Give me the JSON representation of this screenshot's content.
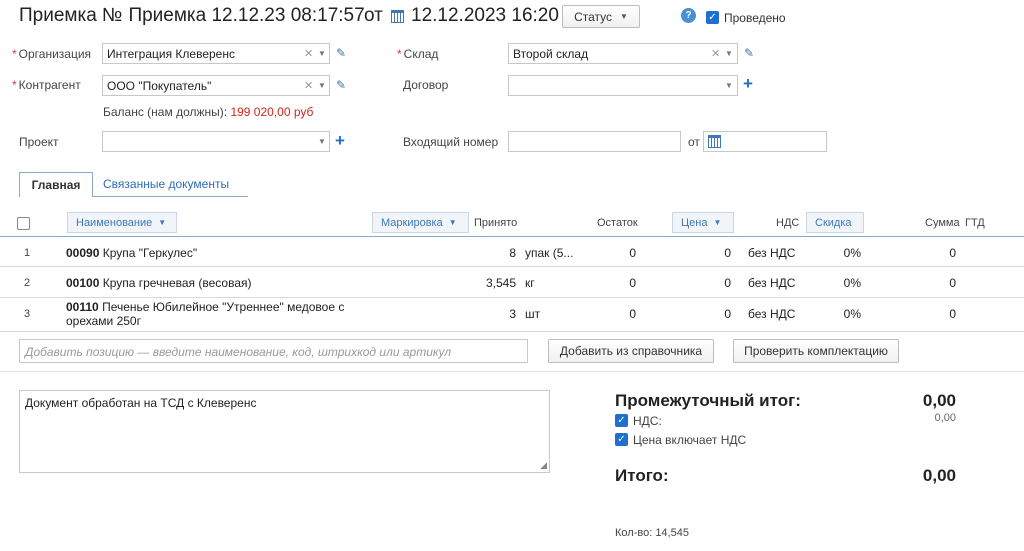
{
  "header": {
    "title": "Приемка №",
    "doc_number": "Приемка 12.12.23 08:17:57",
    "from_label": "от",
    "date": "12.12.2023 16:20",
    "status_label": "Статус",
    "help": "?",
    "posted_label": "Проведено",
    "posted_checked": true
  },
  "form": {
    "organization": {
      "label": "Организация",
      "value": "Интеграция Клеверенс"
    },
    "warehouse": {
      "label": "Склад",
      "value": "Второй склад"
    },
    "counterparty": {
      "label": "Контрагент",
      "value": "ООО \"Покупатель\""
    },
    "contract": {
      "label": "Договор",
      "value": ""
    },
    "balance_label": "Баланс (нам должны):",
    "balance_value": "199 020,00 руб",
    "project": {
      "label": "Проект",
      "value": ""
    },
    "incoming_number": {
      "label": "Входящий номер",
      "value": ""
    },
    "incoming_from_label": "от",
    "incoming_date": ""
  },
  "tabs": [
    {
      "label": "Главная",
      "active": true
    },
    {
      "label": "Связанные документы",
      "active": false
    }
  ],
  "table": {
    "columns": {
      "name": "Наименование",
      "marking": "Маркировка",
      "accepted": "Принято",
      "remainder": "Остаток",
      "price": "Цена",
      "vat": "НДС",
      "discount": "Скидка",
      "sum": "Сумма",
      "gtd": "ГТД"
    },
    "rows": [
      {
        "n": "1",
        "code": "00090",
        "name": "Крупа \"Геркулес\"",
        "name2": "",
        "qty": "8",
        "unit": "упак (5...",
        "remainder": "0",
        "price": "0",
        "vat": "без НДС",
        "discount": "0%",
        "sum": "0"
      },
      {
        "n": "2",
        "code": "00100",
        "name": "Крупа гречневая (весовая)",
        "name2": "",
        "qty": "3,545",
        "unit": "кг",
        "remainder": "0",
        "price": "0",
        "vat": "без НДС",
        "discount": "0%",
        "sum": "0"
      },
      {
        "n": "3",
        "code": "00110",
        "name": "Печенье Юбилейное \"Утреннее\" медовое с",
        "name2": "орехами 250г",
        "qty": "3",
        "unit": "шт",
        "remainder": "0",
        "price": "0",
        "vat": "без НДС",
        "discount": "0%",
        "sum": "0"
      }
    ]
  },
  "add_position": {
    "placeholder": "Добавить позицию — введите наименование, код, штрихкод или артикул",
    "from_catalog_label": "Добавить из справочника",
    "check_kit_label": "Проверить комплектацию"
  },
  "comment": "Документ обработан на ТСД с Клеверенс",
  "totals": {
    "subtotal_label": "Промежуточный итог:",
    "subtotal_value": "0,00",
    "vat_label": "НДС:",
    "vat_value": "0,00",
    "vat_checked": true,
    "price_incl_vat_label": "Цена включает НДС",
    "price_incl_vat_checked": true,
    "total_label": "Итого:",
    "total_value": "0,00",
    "qty_label": "Кол-во: 14,545"
  },
  "colors": {
    "accent": "#1f6fd0",
    "link": "#2d6cb5",
    "balance": "#d0261c"
  }
}
